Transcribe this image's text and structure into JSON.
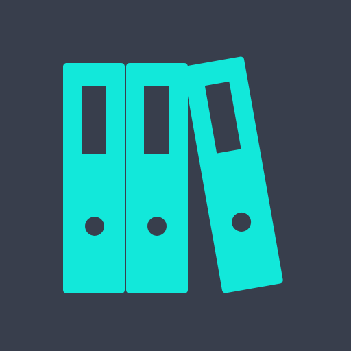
{
  "icon": {
    "name": "binders-icon",
    "background_color": "#383e4c",
    "binder_color": "#12e8da",
    "cutout_color": "#383e4c",
    "binder_count": 3
  }
}
